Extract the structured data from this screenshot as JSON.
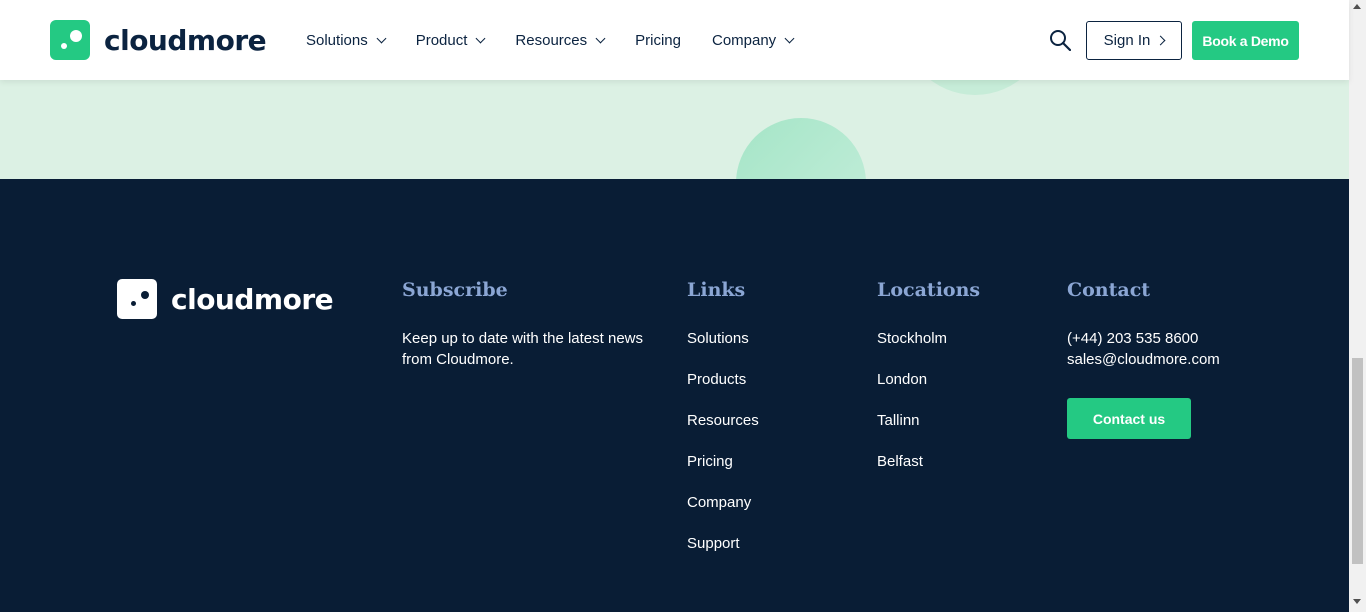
{
  "header": {
    "brand": "cloudmore",
    "nav": [
      {
        "label": "Solutions",
        "dropdown": true
      },
      {
        "label": "Product",
        "dropdown": true
      },
      {
        "label": "Resources",
        "dropdown": true
      },
      {
        "label": "Pricing",
        "dropdown": false
      },
      {
        "label": "Company",
        "dropdown": true
      }
    ],
    "sign_in": "Sign In",
    "book_demo": "Book a Demo"
  },
  "footer": {
    "brand": "cloudmore",
    "subscribe": {
      "heading": "Subscribe",
      "text": "Keep up to date with the latest news from Cloudmore."
    },
    "links": {
      "heading": "Links",
      "items": [
        "Solutions",
        "Products",
        "Resources",
        "Pricing",
        "Company",
        "Support"
      ]
    },
    "locations": {
      "heading": "Locations",
      "items": [
        "Stockholm",
        "London",
        "Tallinn",
        "Belfast"
      ]
    },
    "contact": {
      "heading": "Contact",
      "phone": "(+44) 203 535 8600",
      "email": "sales@cloudmore.com",
      "button": "Contact us"
    }
  },
  "colors": {
    "brand_green": "#24c983",
    "navy": "#091d35",
    "heading_blue": "#8ba6d4",
    "mint": "#dcf1e4"
  },
  "icons": {
    "search": "search-icon",
    "chevron": "chevron-down-icon",
    "sign_in_arrow": "chevron-right-icon"
  }
}
